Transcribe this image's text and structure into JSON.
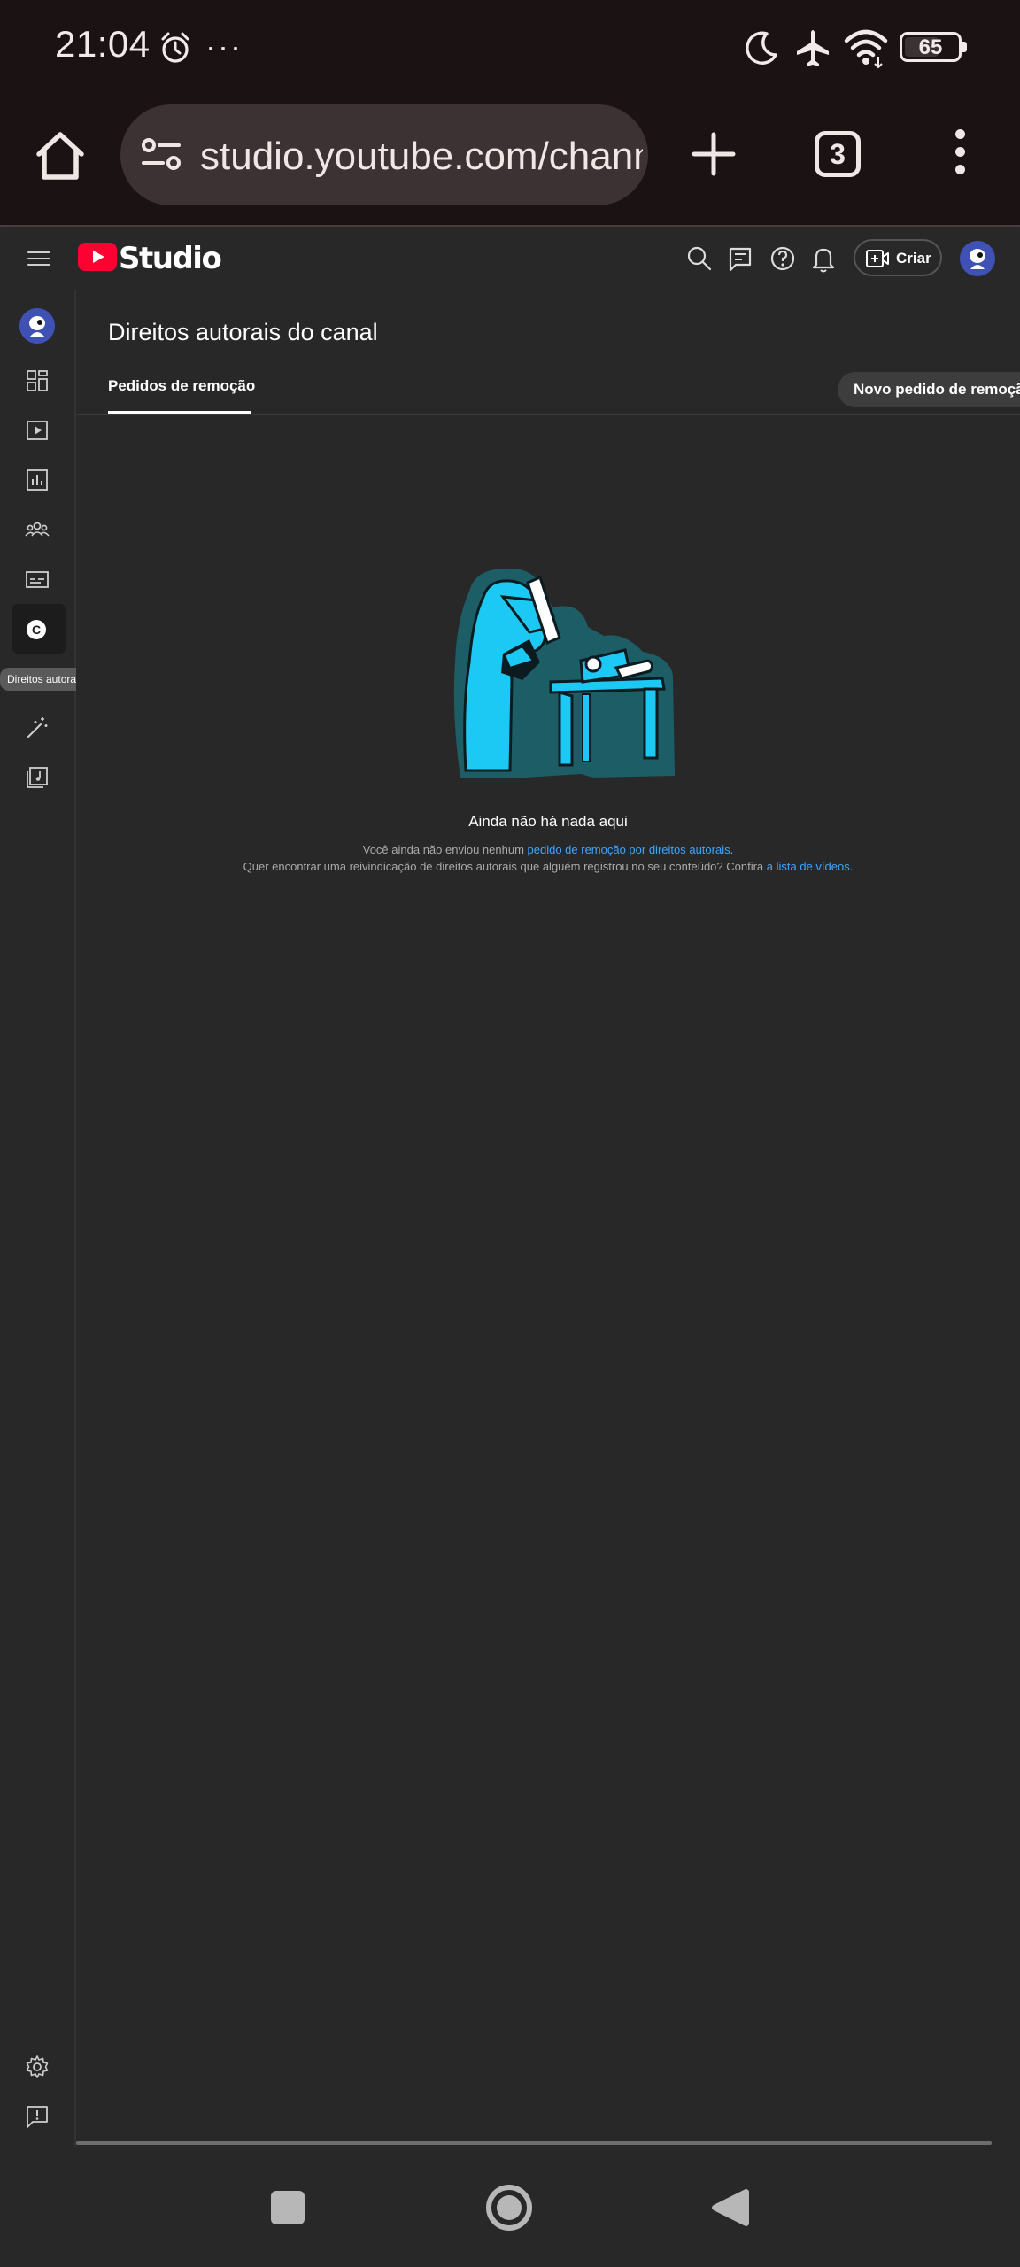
{
  "status_bar": {
    "time": "21:04",
    "more": "···",
    "battery": "65",
    "battery_level_percent": 65,
    "icons": [
      "alarm-icon",
      "moon-icon",
      "airplane-icon",
      "wifi-icon",
      "battery-icon"
    ]
  },
  "browser": {
    "url": "studio.youtube.com/channel",
    "tab_count": "3",
    "icons": [
      "home-icon",
      "site-settings-icon",
      "new-tab-icon",
      "tabs-icon",
      "more-vertical-icon"
    ]
  },
  "studio_header": {
    "logo_text": "Studio",
    "create_label": "Criar",
    "icons": [
      "menu-icon",
      "youtube-logo-icon",
      "search-icon",
      "feedback-icon",
      "help-icon",
      "bell-icon",
      "create-video-icon",
      "avatar"
    ]
  },
  "sidebar": {
    "tooltip": "Direitos autorais",
    "active_item_letter": "C",
    "items": [
      {
        "icon": "avatar"
      },
      {
        "icon": "dashboard-icon"
      },
      {
        "icon": "content-icon"
      },
      {
        "icon": "analytics-icon"
      },
      {
        "icon": "community-icon"
      },
      {
        "icon": "subtitles-icon"
      },
      {
        "icon": "copyright-icon"
      },
      {
        "icon": "customization-icon"
      },
      {
        "icon": "audio-library-icon"
      },
      {
        "icon": "settings-icon"
      },
      {
        "icon": "send-feedback-icon"
      }
    ]
  },
  "main": {
    "page_title": "Direitos autorais do canal",
    "tab_label": "Pedidos de remoção",
    "new_request_button": "Novo pedido de remoção",
    "empty_title": "Ainda não há nada aqui",
    "line1_prefix": "Você ainda não enviou nenhum ",
    "line1_link": "pedido de remoção por direitos autorais",
    "line1_suffix": ".",
    "line2_prefix": "Quer encontrar uma reivindicação de direitos autorais que alguém registrou no seu conteúdo? Confira ",
    "line2_link": "a lista de vídeos",
    "line2_suffix": "."
  },
  "colors": {
    "background": "#282828",
    "accent_link": "#3ea6ff",
    "youtube_red": "#ff0033",
    "illustration_cyan": "#1cc8f4",
    "illustration_teal": "#1d5d66"
  }
}
